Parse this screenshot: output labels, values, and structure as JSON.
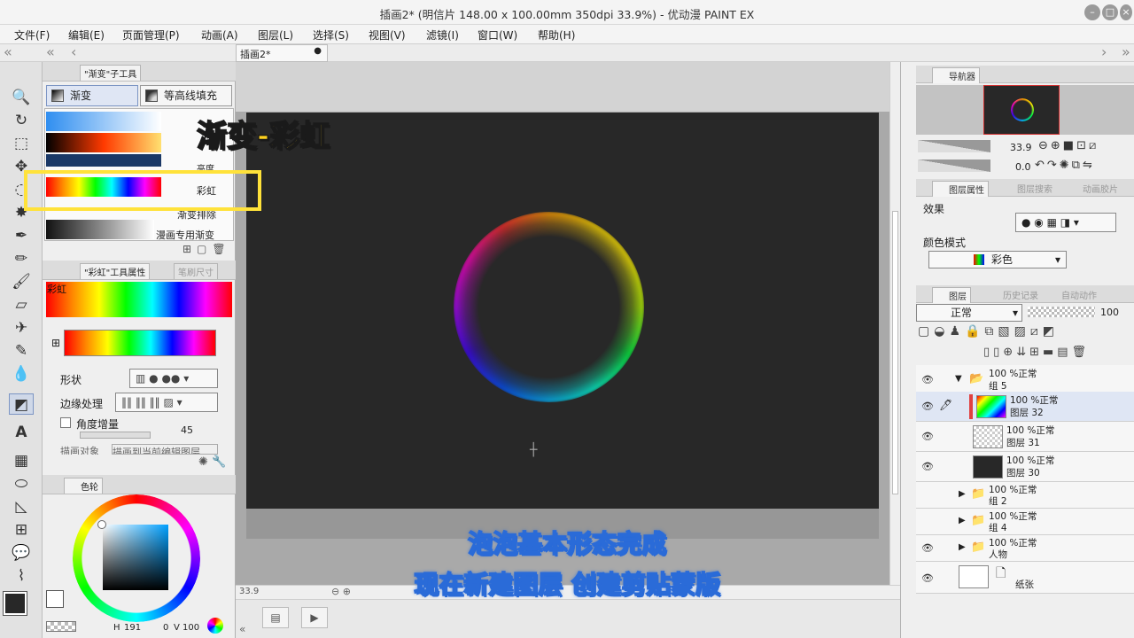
{
  "window": {
    "title": "插画2* (明信片 148.00 x 100.00mm 350dpi 33.9%) - 优动漫 PAINT EX"
  },
  "menu": [
    "文件(F)",
    "编辑(E)",
    "页面管理(P)",
    "动画(A)",
    "图层(L)",
    "选择(S)",
    "视图(V)",
    "滤镜(I)",
    "窗口(W)",
    "帮助(H)"
  ],
  "doc_tab": {
    "label": "插画2*",
    "dot": "●"
  },
  "subtool": {
    "panel_title": "\"渐变\"子工具",
    "tabs": [
      "渐变",
      "等高线填充"
    ],
    "gradients": [
      {
        "label": "",
        "colors": [
          "#2f8ef0",
          "#ffffff"
        ]
      },
      {
        "label": "",
        "colors": [
          "#000000",
          "#ff3a00",
          "#ffe070"
        ]
      },
      {
        "label": "亮度",
        "colors": [
          "#1a1a1a",
          "#444444"
        ]
      },
      {
        "label": "彩虹",
        "colors": [
          "#ff0000",
          "#ffff00",
          "#00ff00",
          "#00ffff",
          "#0000ff",
          "#ff00ff",
          "#ff0000"
        ]
      },
      {
        "label": "渐变排除",
        "colors": []
      },
      {
        "label": "漫画专用渐变",
        "colors": [
          "#111111",
          "#ffffff"
        ]
      }
    ]
  },
  "tool_props": {
    "panel_title": "\"彩虹\"工具属性",
    "panel_tab2": "笔刷尺寸",
    "preset_name": "彩虹",
    "shape_label": "形状",
    "edge_label": "边缘处理",
    "angle_label": "角度增量",
    "angle_value": "45",
    "draw_target_label": "描画对象",
    "draw_target_value": "描画到当前编辑图层"
  },
  "color_panel": {
    "tab": "色轮",
    "values": [
      "191",
      "0",
      "100"
    ]
  },
  "navigator": {
    "tab": "导航器",
    "zoom": "33.9",
    "rotation": "0.0"
  },
  "layer_props": {
    "tabs": [
      "图层属性",
      "图层搜索",
      "动画胶片"
    ],
    "effect_label": "效果",
    "color_mode_label": "颜色模式",
    "color_mode_value": "彩色"
  },
  "layers_panel": {
    "tabs": [
      "图层",
      "历史记录",
      "自动动作"
    ],
    "blend_mode": "正常",
    "opacity": "100",
    "layers": [
      {
        "line1": "100 %正常",
        "line2": "组 5",
        "type": "folder",
        "open": true,
        "visible": true
      },
      {
        "line1": "100 %正常",
        "line2": "图层 32",
        "type": "rainbow",
        "visible": true,
        "selected": true
      },
      {
        "line1": "100 %正常",
        "line2": "图层 31",
        "type": "transparent",
        "visible": true
      },
      {
        "line1": "100 %正常",
        "line2": "图层 30",
        "type": "dark",
        "visible": true
      },
      {
        "line1": "100 %正常",
        "line2": "组 2",
        "type": "folder",
        "open": false,
        "visible": false
      },
      {
        "line1": "100 %正常",
        "line2": "组 4",
        "type": "folder",
        "open": false,
        "visible": false
      },
      {
        "line1": "100 %正常",
        "line2": "人物",
        "type": "folder",
        "open": false,
        "visible": true
      },
      {
        "line1": "",
        "line2": "纸张",
        "type": "paper",
        "visible": true
      }
    ]
  },
  "status": {
    "zoom": "33.9"
  },
  "captions": {
    "gradient_rainbow": "渐变-彩虹",
    "line1": "泡泡基本形态完成",
    "line2": "现在新建图层 创建剪贴蒙版"
  }
}
